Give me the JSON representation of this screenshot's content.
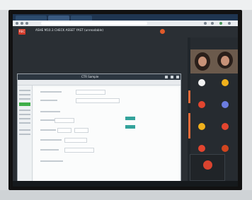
{
  "browser": {
    "tabs": [
      "",
      "",
      ""
    ],
    "address": ""
  },
  "meeting": {
    "record_label": "REC",
    "title": "ASHE M10.3 CHECK ASSET YAST (unreadable)",
    "user_line1": "",
    "user_line2": ""
  },
  "app": {
    "window_title": "CTR Sample",
    "toolbar_items": [
      "",
      "",
      "",
      "",
      "",
      ""
    ],
    "form_labels": [
      "",
      "",
      "",
      "",
      "",
      ""
    ]
  },
  "participants": [
    {
      "name": "",
      "color": "#f2f2f2"
    },
    {
      "name": "",
      "color": "#f0b11c"
    },
    {
      "name": "",
      "color": "#e3452f"
    },
    {
      "name": "",
      "color": "#6c7de0"
    },
    {
      "name": "",
      "color": "#f0b11c"
    },
    {
      "name": "",
      "color": "#e3452f"
    },
    {
      "name": "",
      "color": "#e3452f"
    },
    {
      "name": "",
      "color": "#d1451f"
    }
  ],
  "featured": {
    "name": ""
  },
  "colors": {
    "accent_green": "#3fae49",
    "teal_button": "#33a39b",
    "record_red": "#d23a2a"
  }
}
